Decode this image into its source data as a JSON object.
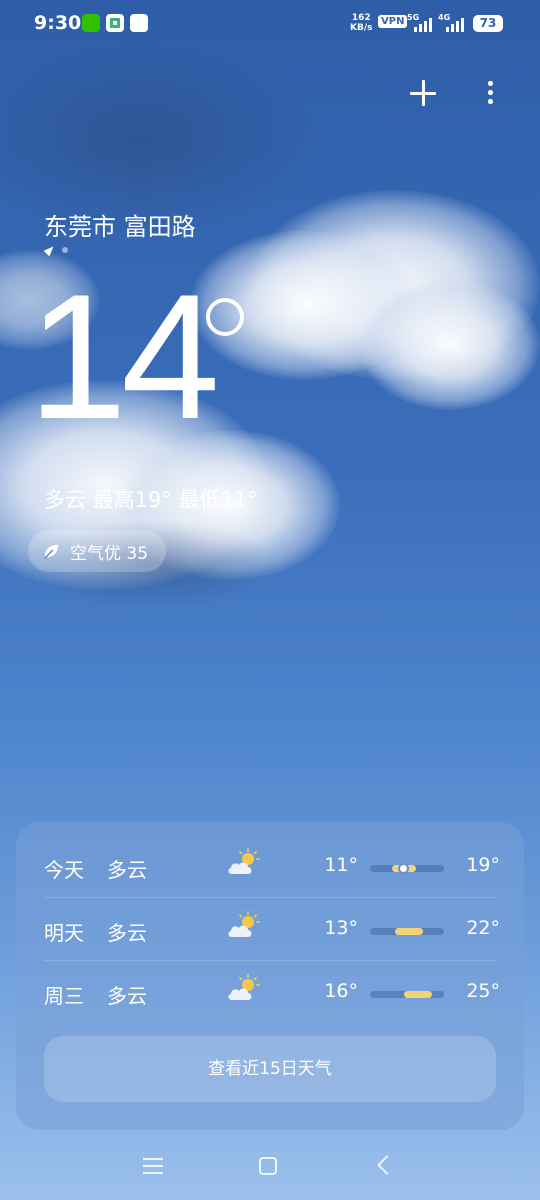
{
  "status_bar": {
    "time": "9:30",
    "net_speed_value": "162",
    "net_speed_unit": "KB/s",
    "vpn": "VPN",
    "sim1": "5G",
    "sim2": "4G",
    "battery": "73",
    "icons": [
      "wechat-icon",
      "app-icon",
      "data-icon"
    ]
  },
  "header": {
    "location": "东莞市 富田路",
    "add_icon": "plus-icon",
    "more_icon": "more-vertical-icon"
  },
  "current": {
    "temp": "14",
    "condition_line": "多云  最高19°  最低11°",
    "aqi": "空气优 35"
  },
  "forecast": [
    {
      "day": "今天",
      "cond": "多云",
      "icon": "partly-cloudy-icon",
      "low": "11°",
      "high": "19°",
      "bar_start": 0.3,
      "bar_end": 0.62,
      "has_now": true
    },
    {
      "day": "明天",
      "cond": "多云",
      "icon": "partly-cloudy-icon",
      "low": "13°",
      "high": "22°",
      "bar_start": 0.34,
      "bar_end": 0.72,
      "has_now": false
    },
    {
      "day": "周三",
      "cond": "多云",
      "icon": "partly-cloudy-icon",
      "low": "16°",
      "high": "25°",
      "bar_start": 0.46,
      "bar_end": 0.84,
      "has_now": false
    }
  ],
  "forecast_button": "查看近15日天气",
  "colors": {
    "sky_top": "#2f5ea8",
    "sky_bottom": "#9cc0ec",
    "temp_bar": "#f3d27a"
  }
}
